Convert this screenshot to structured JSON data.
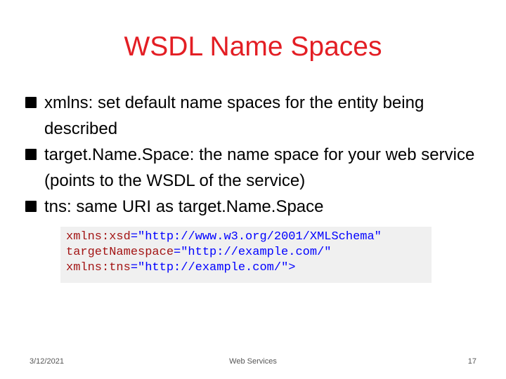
{
  "slide": {
    "title": "WSDL Name Spaces",
    "bullets": [
      {
        "term": "xmlns",
        "text": ": set default name spaces for the entity being described"
      },
      {
        "term": "target.Name.Space",
        "text": ": the name space for your web service (points to the WSDL of the service)"
      },
      {
        "term": "tns",
        "text": ": same URI as target.Name.Space"
      }
    ],
    "code_lines": [
      {
        "attr": "xmlns:xsd",
        "eq": "=",
        "value": "\"http://www.w3.org/2001/XMLSchema\""
      },
      {
        "attr": "targetNamespace",
        "eq": "=",
        "value": "\"http://example.com/\""
      },
      {
        "attr": "xmlns:tns",
        "eq": "=",
        "value": "\"http://example.com/\">"
      }
    ]
  },
  "footer": {
    "date": "3/12/2021",
    "center": "Web Services",
    "page_number": "17"
  },
  "colors": {
    "title": "#e31e24",
    "code_attr": "#a31515",
    "code_value": "#0000ff"
  }
}
